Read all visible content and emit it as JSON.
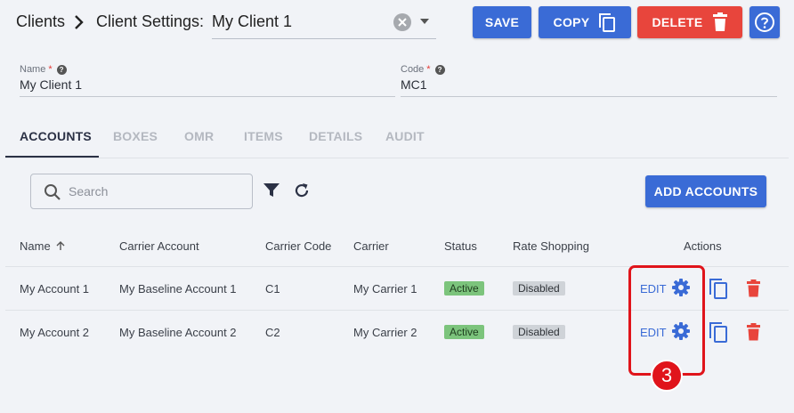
{
  "breadcrumb": {
    "clients": "Clients",
    "settings": "Client Settings:"
  },
  "client_select": {
    "value": "My Client 1"
  },
  "toolbar": {
    "save": "SAVE",
    "copy": "COPY",
    "delete": "DELETE"
  },
  "fields": {
    "name": {
      "label": "Name",
      "required": "*",
      "value": "My Client 1"
    },
    "code": {
      "label": "Code",
      "required": "*",
      "value": "MC1"
    }
  },
  "tabs": [
    "ACCOUNTS",
    "BOXES",
    "OMR",
    "ITEMS",
    "DETAILS",
    "AUDIT"
  ],
  "active_tab": "ACCOUNTS",
  "search": {
    "placeholder": "Search"
  },
  "add_accounts": "ADD ACCOUNTS",
  "table": {
    "headers": [
      "Name",
      "Carrier Account",
      "Carrier Code",
      "Carrier",
      "Status",
      "Rate Shopping",
      "Actions"
    ],
    "rows": [
      {
        "name": "My Account 1",
        "carrier_account": "My Baseline Account 1",
        "carrier_code": "C1",
        "carrier": "My Carrier 1",
        "status": "Active",
        "rate_shopping": "Disabled",
        "edit": "EDIT"
      },
      {
        "name": "My Account 2",
        "carrier_account": "My Baseline Account 2",
        "carrier_code": "C2",
        "carrier": "My Carrier 2",
        "status": "Active",
        "rate_shopping": "Disabled",
        "edit": "EDIT"
      }
    ]
  },
  "annotation": {
    "step": "3"
  },
  "colors": {
    "primary": "#3a6bd6",
    "danger": "#e8453c",
    "active_badge": "#7cc47c",
    "annotation": "#e0141b"
  },
  "icons": [
    "chevron-right-icon",
    "clear-icon",
    "dropdown-icon",
    "copy-icon",
    "trash-icon",
    "help-icon",
    "search-icon",
    "filter-icon",
    "refresh-icon",
    "sort-up-icon",
    "gear-icon"
  ]
}
